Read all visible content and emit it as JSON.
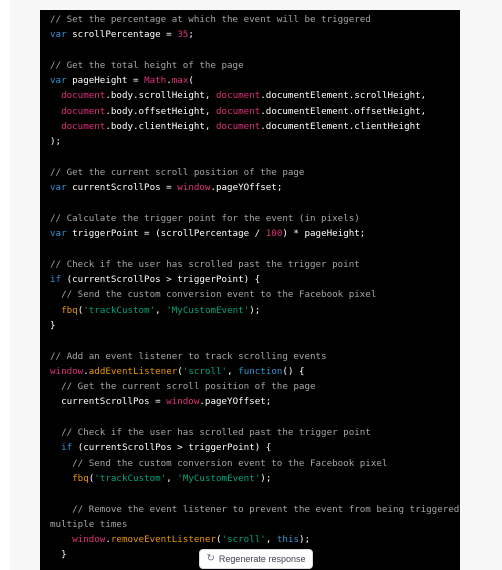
{
  "code": {
    "lines": [
      [
        [
          "c",
          "// Set the percentage at which the event will be triggered"
        ]
      ],
      [
        [
          "k",
          "var"
        ],
        [
          "p",
          " scrollPercentage = "
        ],
        [
          "n",
          "35"
        ],
        [
          "p",
          ";"
        ]
      ],
      [],
      [
        [
          "c",
          "// Get the total height of the page"
        ]
      ],
      [
        [
          "k",
          "var"
        ],
        [
          "p",
          " pageHeight = "
        ],
        [
          "n",
          "Math"
        ],
        [
          "p",
          "."
        ],
        [
          "n",
          "max"
        ],
        [
          "p",
          "("
        ]
      ],
      [
        [
          "p",
          "  "
        ],
        [
          "n",
          "document"
        ],
        [
          "p",
          ".body.scrollHeight, "
        ],
        [
          "n",
          "document"
        ],
        [
          "p",
          ".documentElement.scrollHeight,"
        ]
      ],
      [
        [
          "p",
          "  "
        ],
        [
          "n",
          "document"
        ],
        [
          "p",
          ".body.offsetHeight, "
        ],
        [
          "n",
          "document"
        ],
        [
          "p",
          ".documentElement.offsetHeight,"
        ]
      ],
      [
        [
          "p",
          "  "
        ],
        [
          "n",
          "document"
        ],
        [
          "p",
          ".body.clientHeight, "
        ],
        [
          "n",
          "document"
        ],
        [
          "p",
          ".documentElement.clientHeight"
        ]
      ],
      [
        [
          "p",
          ");"
        ]
      ],
      [],
      [
        [
          "c",
          "// Get the current scroll position of the page"
        ]
      ],
      [
        [
          "k",
          "var"
        ],
        [
          "p",
          " currentScrollPos = "
        ],
        [
          "n",
          "window"
        ],
        [
          "p",
          ".pageYOffset;"
        ]
      ],
      [],
      [
        [
          "c",
          "// Calculate the trigger point for the event (in pixels)"
        ]
      ],
      [
        [
          "k",
          "var"
        ],
        [
          "p",
          " triggerPoint = (scrollPercentage / "
        ],
        [
          "n",
          "100"
        ],
        [
          "p",
          ") * pageHeight;"
        ]
      ],
      [],
      [
        [
          "c",
          "// Check if the user has scrolled past the trigger point"
        ]
      ],
      [
        [
          "k",
          "if"
        ],
        [
          "p",
          " (currentScrollPos > triggerPoint) {"
        ]
      ],
      [
        [
          "p",
          "  "
        ],
        [
          "c",
          "// Send the custom conversion event to the Facebook pixel"
        ]
      ],
      [
        [
          "p",
          "  "
        ],
        [
          "b",
          "fbq"
        ],
        [
          "p",
          "("
        ],
        [
          "s",
          "'trackCustom'"
        ],
        [
          "p",
          ", "
        ],
        [
          "s",
          "'MyCustomEvent'"
        ],
        [
          "p",
          ");"
        ]
      ],
      [
        [
          "p",
          "}"
        ]
      ],
      [],
      [
        [
          "c",
          "// Add an event listener to track scrolling events"
        ]
      ],
      [
        [
          "n",
          "window"
        ],
        [
          "p",
          "."
        ],
        [
          "b",
          "addEventListener"
        ],
        [
          "p",
          "("
        ],
        [
          "s",
          "'scroll'"
        ],
        [
          "p",
          ", "
        ],
        [
          "k",
          "function"
        ],
        [
          "p",
          "() {"
        ]
      ],
      [
        [
          "p",
          "  "
        ],
        [
          "c",
          "// Get the current scroll position of the page"
        ]
      ],
      [
        [
          "p",
          "  currentScrollPos = "
        ],
        [
          "n",
          "window"
        ],
        [
          "p",
          ".pageYOffset;"
        ]
      ],
      [],
      [
        [
          "p",
          "  "
        ],
        [
          "c",
          "// Check if the user has scrolled past the trigger point"
        ]
      ],
      [
        [
          "p",
          "  "
        ],
        [
          "k",
          "if"
        ],
        [
          "p",
          " (currentScrollPos > triggerPoint) {"
        ]
      ],
      [
        [
          "p",
          "    "
        ],
        [
          "c",
          "// Send the custom conversion event to the Facebook pixel"
        ]
      ],
      [
        [
          "p",
          "    "
        ],
        [
          "b",
          "fbq"
        ],
        [
          "p",
          "("
        ],
        [
          "s",
          "'trackCustom'"
        ],
        [
          "p",
          ", "
        ],
        [
          "s",
          "'MyCustomEvent'"
        ],
        [
          "p",
          ");"
        ]
      ],
      [],
      [
        [
          "p",
          "    "
        ],
        [
          "c",
          "// Remove the event listener to prevent the event from being triggered"
        ]
      ],
      [
        [
          "c",
          "multiple times"
        ]
      ],
      [
        [
          "p",
          "    "
        ],
        [
          "n",
          "window"
        ],
        [
          "p",
          "."
        ],
        [
          "b",
          "removeEventListener"
        ],
        [
          "p",
          "("
        ],
        [
          "s",
          "'scroll'"
        ],
        [
          "p",
          ", "
        ],
        [
          "k",
          "this"
        ],
        [
          "p",
          ");"
        ]
      ],
      [
        [
          "p",
          "  }"
        ]
      ]
    ]
  },
  "regenerate": {
    "label": "Regenerate response",
    "icon": "refresh-icon"
  }
}
